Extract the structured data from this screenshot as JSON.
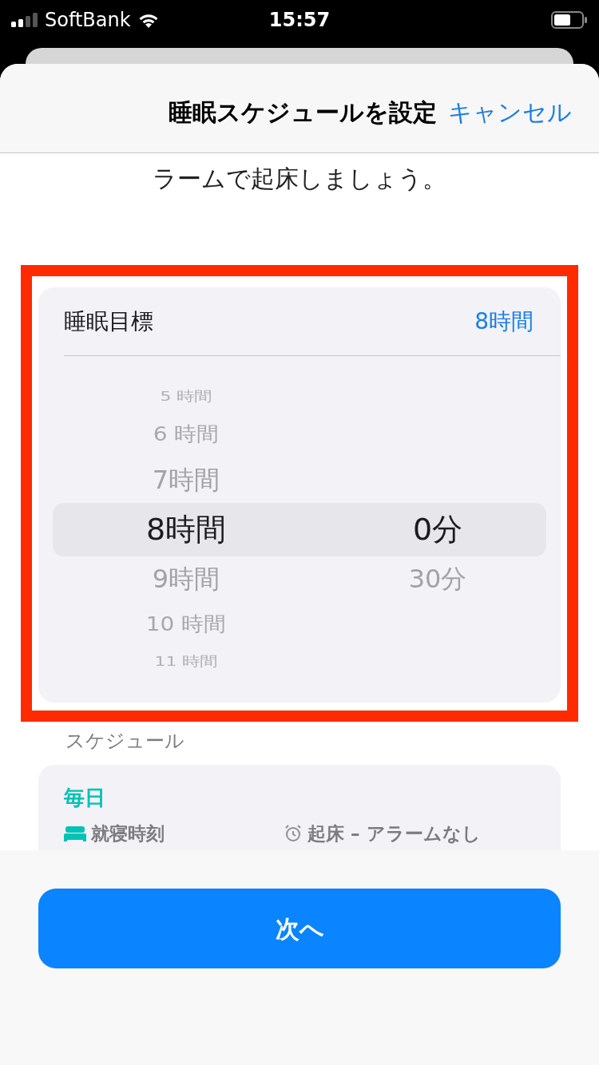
{
  "status_bar": {
    "carrier": "SoftBank",
    "time": "15:57"
  },
  "sheet": {
    "title": "睡眠スケジュールを設定",
    "cancel": "キャンセル",
    "intro": "ラームで起床しましょう。"
  },
  "sleep_goal": {
    "label": "睡眠目標",
    "value": "8時間",
    "hours": [
      {
        "label": "5 時間",
        "selected": false
      },
      {
        "label": "6 時間",
        "selected": false
      },
      {
        "label": "7時間",
        "selected": false
      },
      {
        "label": "8時間",
        "selected": true
      },
      {
        "label": "9時間",
        "selected": false
      },
      {
        "label": "10 時間",
        "selected": false
      },
      {
        "label": "11 時間",
        "selected": false
      }
    ],
    "minutes": [
      {
        "label": "0分",
        "selected": true
      },
      {
        "label": "30分",
        "selected": false
      }
    ]
  },
  "schedule": {
    "heading": "スケジュール",
    "days": "毎日",
    "bedtime_label": "就寝時刻",
    "wake_label": "起床 – アラームなし"
  },
  "next_button": "次へ"
}
